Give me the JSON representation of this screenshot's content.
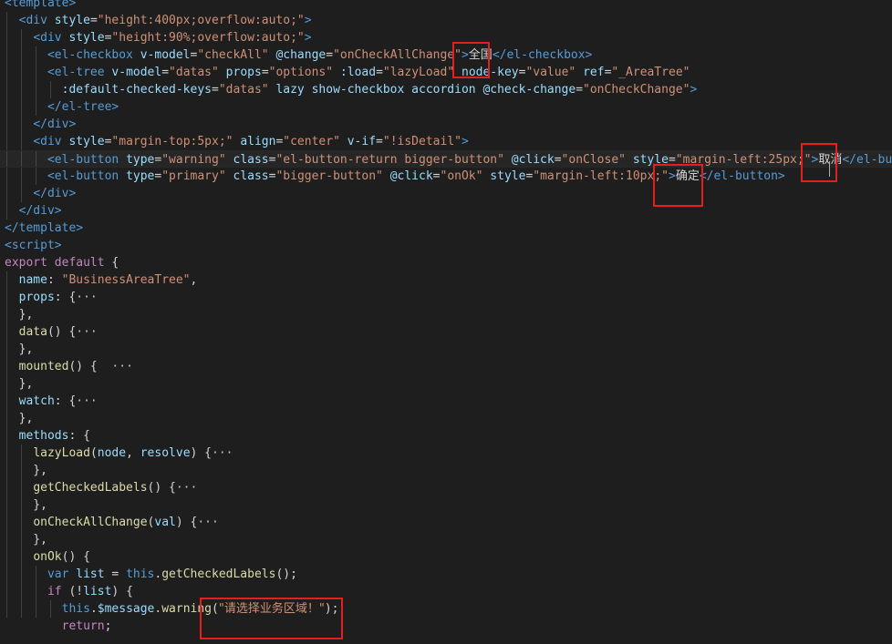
{
  "editor": {
    "lines": [
      [
        [
          "c-tag",
          "<template>"
        ]
      ],
      [
        [
          "c-text",
          "  "
        ],
        [
          "c-tag",
          "<div"
        ],
        [
          "c-text",
          " "
        ],
        [
          "c-attr",
          "style"
        ],
        [
          "c-text",
          "="
        ],
        [
          "c-str",
          "\"height:400px;overflow:auto;\""
        ],
        [
          "c-tag",
          ">"
        ]
      ],
      [
        [
          "c-text",
          "    "
        ],
        [
          "c-tag",
          "<div"
        ],
        [
          "c-text",
          " "
        ],
        [
          "c-attr",
          "style"
        ],
        [
          "c-text",
          "="
        ],
        [
          "c-str",
          "\"height:90%;overflow:auto;\""
        ],
        [
          "c-tag",
          ">"
        ]
      ],
      [
        [
          "c-text",
          "      "
        ],
        [
          "c-tag",
          "<el-checkbox"
        ],
        [
          "c-text",
          " "
        ],
        [
          "c-attr",
          "v-model"
        ],
        [
          "c-text",
          "="
        ],
        [
          "c-str",
          "\"checkAll\""
        ],
        [
          "c-text",
          " "
        ],
        [
          "c-attr",
          "@change"
        ],
        [
          "c-text",
          "="
        ],
        [
          "c-str",
          "\"onCheckAllChange\""
        ],
        [
          "c-tag",
          ">"
        ],
        [
          "c-text cjk",
          "全国"
        ],
        [
          "c-tag",
          "</el-checkbox>"
        ]
      ],
      [
        [
          "c-text",
          "      "
        ],
        [
          "c-tag",
          "<el-tree"
        ],
        [
          "c-text",
          " "
        ],
        [
          "c-attr",
          "v-model"
        ],
        [
          "c-text",
          "="
        ],
        [
          "c-str",
          "\"datas\""
        ],
        [
          "c-text",
          " "
        ],
        [
          "c-attr",
          "props"
        ],
        [
          "c-text",
          "="
        ],
        [
          "c-str",
          "\"options\""
        ],
        [
          "c-text",
          " "
        ],
        [
          "c-attr",
          ":load"
        ],
        [
          "c-text",
          "="
        ],
        [
          "c-str",
          "\"lazyLoad\""
        ],
        [
          "c-text",
          " "
        ],
        [
          "c-attr",
          "node-key"
        ],
        [
          "c-text",
          "="
        ],
        [
          "c-str",
          "\"value\""
        ],
        [
          "c-text",
          " "
        ],
        [
          "c-attr",
          "ref"
        ],
        [
          "c-text",
          "="
        ],
        [
          "c-str",
          "\"_AreaTree\""
        ]
      ],
      [
        [
          "c-text",
          "        "
        ],
        [
          "c-attr",
          ":default-checked-keys"
        ],
        [
          "c-text",
          "="
        ],
        [
          "c-str",
          "\"datas\""
        ],
        [
          "c-text",
          " "
        ],
        [
          "c-attr",
          "lazy"
        ],
        [
          "c-text",
          " "
        ],
        [
          "c-attr",
          "show-checkbox"
        ],
        [
          "c-text",
          " "
        ],
        [
          "c-attr",
          "accordion"
        ],
        [
          "c-text",
          " "
        ],
        [
          "c-attr",
          "@check-change"
        ],
        [
          "c-text",
          "="
        ],
        [
          "c-str",
          "\"onCheckChange\""
        ],
        [
          "c-tag",
          ">"
        ]
      ],
      [
        [
          "c-text",
          "      "
        ],
        [
          "c-tag",
          "</el-tree>"
        ]
      ],
      [
        [
          "c-text",
          "    "
        ],
        [
          "c-tag",
          "</div>"
        ]
      ],
      [
        [
          "c-text",
          "    "
        ],
        [
          "c-tag",
          "<div"
        ],
        [
          "c-text",
          " "
        ],
        [
          "c-attr",
          "style"
        ],
        [
          "c-text",
          "="
        ],
        [
          "c-str",
          "\"margin-top:5px;\""
        ],
        [
          "c-text",
          " "
        ],
        [
          "c-attr",
          "align"
        ],
        [
          "c-text",
          "="
        ],
        [
          "c-str",
          "\"center\""
        ],
        [
          "c-text",
          " "
        ],
        [
          "c-attr",
          "v-if"
        ],
        [
          "c-text",
          "="
        ],
        [
          "c-str",
          "\"!isDetail\""
        ],
        [
          "c-tag",
          ">"
        ]
      ],
      [
        [
          "c-text",
          "      "
        ],
        [
          "c-tag",
          "<el-button"
        ],
        [
          "c-text",
          " "
        ],
        [
          "c-attr",
          "type"
        ],
        [
          "c-text",
          "="
        ],
        [
          "c-str",
          "\"warning\""
        ],
        [
          "c-text",
          " "
        ],
        [
          "c-attr",
          "class"
        ],
        [
          "c-text",
          "="
        ],
        [
          "c-str",
          "\"el-button-return bigger-button\""
        ],
        [
          "c-text",
          " "
        ],
        [
          "c-attr",
          "@click"
        ],
        [
          "c-text",
          "="
        ],
        [
          "c-str",
          "\"onClose\""
        ],
        [
          "c-text",
          " "
        ],
        [
          "c-attr",
          "style"
        ],
        [
          "c-text",
          "="
        ],
        [
          "c-str",
          "\"margin-left:25px;\""
        ],
        [
          "c-tag",
          ">"
        ],
        [
          "c-text cjk",
          "取消"
        ],
        [
          "c-tag",
          "</el-butt"
        ]
      ],
      [
        [
          "c-text",
          "      "
        ],
        [
          "c-tag",
          "<el-button"
        ],
        [
          "c-text",
          " "
        ],
        [
          "c-attr",
          "type"
        ],
        [
          "c-text",
          "="
        ],
        [
          "c-str",
          "\"primary\""
        ],
        [
          "c-text",
          " "
        ],
        [
          "c-attr",
          "class"
        ],
        [
          "c-text",
          "="
        ],
        [
          "c-str",
          "\"bigger-button\""
        ],
        [
          "c-text",
          " "
        ],
        [
          "c-attr",
          "@click"
        ],
        [
          "c-text",
          "="
        ],
        [
          "c-str",
          "\"onOk\""
        ],
        [
          "c-text",
          " "
        ],
        [
          "c-attr",
          "style"
        ],
        [
          "c-text",
          "="
        ],
        [
          "c-str",
          "\"margin-left:10px;\""
        ],
        [
          "c-tag",
          ">"
        ],
        [
          "c-text cjk",
          "确定"
        ],
        [
          "c-tag",
          "</el-button>"
        ]
      ],
      [
        [
          "c-text",
          "    "
        ],
        [
          "c-tag",
          "</div>"
        ]
      ],
      [
        [
          "c-text",
          "  "
        ],
        [
          "c-tag",
          "</div>"
        ]
      ],
      [
        [
          "c-tag",
          "</template>"
        ]
      ],
      [
        [
          "c-tag",
          "<script>"
        ]
      ],
      [
        [
          "c-ctrl",
          "export"
        ],
        [
          "c-text",
          " "
        ],
        [
          "c-ctrl",
          "default"
        ],
        [
          "c-text",
          " {"
        ]
      ],
      [
        [
          "c-text",
          "  "
        ],
        [
          "c-var",
          "name"
        ],
        [
          "c-text",
          ": "
        ],
        [
          "c-str",
          "\"BusinessAreaTree\""
        ],
        [
          "c-text",
          ","
        ]
      ],
      [
        [
          "c-text",
          "  "
        ],
        [
          "c-var",
          "props"
        ],
        [
          "c-text",
          ": {"
        ],
        [
          "c-fold",
          "···"
        ]
      ],
      [
        [
          "c-text",
          "  },"
        ]
      ],
      [
        [
          "c-text",
          "  "
        ],
        [
          "c-func",
          "data"
        ],
        [
          "c-text",
          "() {"
        ],
        [
          "c-fold",
          "···"
        ]
      ],
      [
        [
          "c-text",
          "  },"
        ]
      ],
      [
        [
          "c-text",
          "  "
        ],
        [
          "c-func",
          "mounted"
        ],
        [
          "c-text",
          "() {  "
        ],
        [
          "c-fold",
          "···"
        ]
      ],
      [
        [
          "c-text",
          "  },"
        ]
      ],
      [
        [
          "c-text",
          "  "
        ],
        [
          "c-var",
          "watch"
        ],
        [
          "c-text",
          ": {"
        ],
        [
          "c-fold",
          "···"
        ]
      ],
      [
        [
          "c-text",
          "  },"
        ]
      ],
      [
        [
          "c-text",
          "  "
        ],
        [
          "c-var",
          "methods"
        ],
        [
          "c-text",
          ": {"
        ]
      ],
      [
        [
          "c-text",
          "    "
        ],
        [
          "c-func",
          "lazyLoad"
        ],
        [
          "c-text",
          "("
        ],
        [
          "c-var",
          "node"
        ],
        [
          "c-text",
          ", "
        ],
        [
          "c-var",
          "resolve"
        ],
        [
          "c-text",
          ") {"
        ],
        [
          "c-fold",
          "···"
        ]
      ],
      [
        [
          "c-text",
          "    },"
        ]
      ],
      [
        [
          "c-text",
          "    "
        ],
        [
          "c-func",
          "getCheckedLabels"
        ],
        [
          "c-text",
          "() {"
        ],
        [
          "c-fold",
          "···"
        ]
      ],
      [
        [
          "c-text",
          "    },"
        ]
      ],
      [
        [
          "c-text",
          "    "
        ],
        [
          "c-func",
          "onCheckAllChange"
        ],
        [
          "c-text",
          "("
        ],
        [
          "c-var",
          "val"
        ],
        [
          "c-text",
          ") {"
        ],
        [
          "c-fold",
          "···"
        ]
      ],
      [
        [
          "c-text",
          "    },"
        ]
      ],
      [
        [
          "c-text",
          "    "
        ],
        [
          "c-func",
          "onOk"
        ],
        [
          "c-text",
          "() {"
        ]
      ],
      [
        [
          "c-text",
          "      "
        ],
        [
          "c-kw",
          "var"
        ],
        [
          "c-text",
          " "
        ],
        [
          "c-var",
          "list"
        ],
        [
          "c-text",
          " = "
        ],
        [
          "c-kw",
          "this"
        ],
        [
          "c-text",
          "."
        ],
        [
          "c-func",
          "getCheckedLabels"
        ],
        [
          "c-text",
          "();"
        ]
      ],
      [
        [
          "c-text",
          "      "
        ],
        [
          "c-ctrl",
          "if"
        ],
        [
          "c-text",
          " (!"
        ],
        [
          "c-var",
          "list"
        ],
        [
          "c-text",
          ") {"
        ]
      ],
      [
        [
          "c-text",
          "        "
        ],
        [
          "c-kw",
          "this"
        ],
        [
          "c-text",
          "."
        ],
        [
          "c-var",
          "$message"
        ],
        [
          "c-text",
          "."
        ],
        [
          "c-func",
          "warning"
        ],
        [
          "c-text",
          "("
        ],
        [
          "c-str cjk",
          "\"请选择业务区域！\""
        ],
        [
          "c-text",
          ");"
        ]
      ],
      [
        [
          "c-text",
          "        "
        ],
        [
          "c-ctrl",
          "return"
        ],
        [
          "c-text",
          ";"
        ]
      ]
    ],
    "current_line": 9,
    "highlights": [
      {
        "label": "全国"
      },
      {
        "label": "取消"
      },
      {
        "label": "确定"
      },
      {
        "label": "请选择业务区域！"
      }
    ]
  }
}
